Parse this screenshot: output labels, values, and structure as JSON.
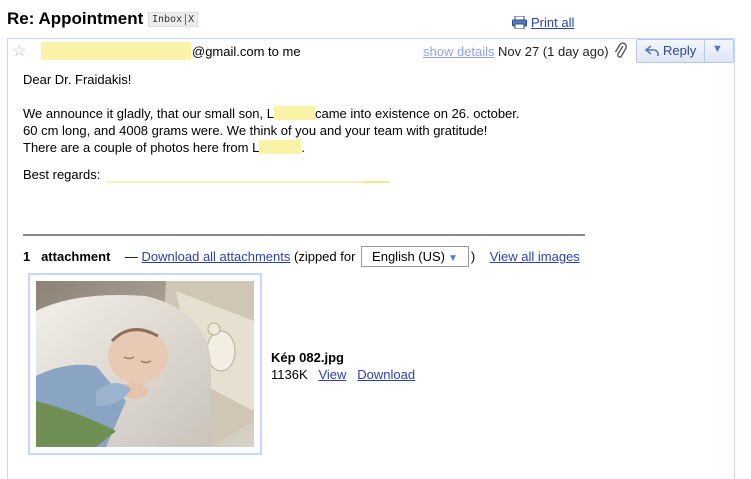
{
  "subject": "Re: Appointment",
  "label": {
    "name": "Inbox",
    "remove": "X"
  },
  "print_all": "Print all",
  "header": {
    "from_rest": "@gmail.com to me",
    "show_details": "show details",
    "date": "Nov 27 (1 day ago)",
    "reply": "Reply"
  },
  "body": {
    "greeting": "Dear Dr. Fraidakis!",
    "line1a": "We announce it gladly, that our small son, L",
    "line1b": "came into existence on 26. october.",
    "line2": "60 cm long, and 4008 grams were. We think of you and your team with gratitude!",
    "line3a": "There are a couple of photos here from L",
    "line3b": ".",
    "regards": "Best regards:"
  },
  "attachments": {
    "count": "1",
    "label": "attachment",
    "dash": "—",
    "download_all": "Download all attachments",
    "zipped_for": "(zipped for",
    "language": "English (US)",
    "close_paren": ")",
    "view_all_images": "View all images",
    "file": {
      "name": "Kép 082.jpg",
      "size": "1136K",
      "view": "View",
      "download": "Download"
    }
  },
  "colors": {
    "link": "#2a3fb1",
    "border": "#c3d9ff",
    "highlight": "#f9f3a8"
  },
  "icons": [
    "star-icon",
    "printer-icon",
    "paperclip-icon",
    "reply-arrow-icon",
    "dropdown-icon"
  ]
}
